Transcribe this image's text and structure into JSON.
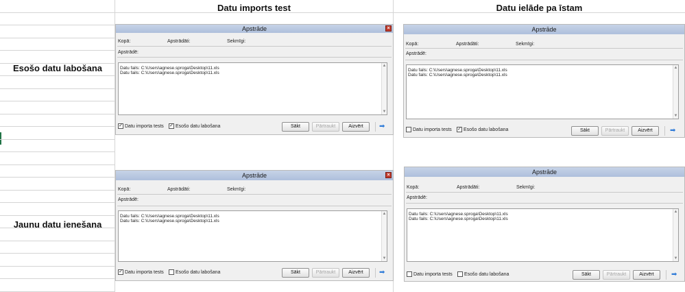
{
  "columns": {
    "test": "Datu imports test",
    "real": "Datu ielāde pa īstam"
  },
  "rows": {
    "existing": "Esošo datu labošana",
    "new": "Jaunu datu ienešana"
  },
  "dialog": {
    "title": "Apstrāde",
    "close_glyph": "×",
    "total_label": "Kopā:",
    "processed_label": "Apstrādāti:",
    "success_label": "Sekmīgi:",
    "processing_label": "Apstrādē:",
    "log_lines": [
      "Datu fails: C:\\Users\\agnese.sproga\\Desktop\\11.xls",
      "Datu fails: C:\\Users\\agnese.sproga\\Desktop\\11.xls"
    ],
    "chk_import_test": "Datu importa tests",
    "chk_existing": "Esošo datu labošana",
    "btn_start": "Sākt",
    "btn_interrupt": "Pārtraukt",
    "btn_close": "Aizvērt",
    "arrow_icon": "forward-arrow-icon"
  },
  "states": {
    "d1": {
      "import_test": true,
      "existing": true
    },
    "d2": {
      "import_test": false,
      "existing": true
    },
    "d3": {
      "import_test": true,
      "existing": false
    },
    "d4": {
      "import_test": false,
      "existing": false
    }
  }
}
